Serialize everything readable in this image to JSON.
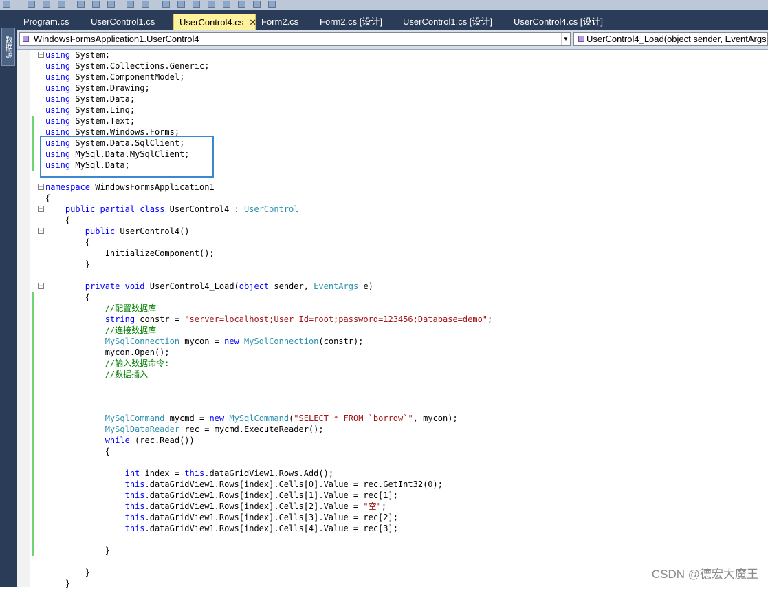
{
  "tabs": [
    {
      "label": "Program.cs",
      "active": false
    },
    {
      "label": "UserControl1.cs",
      "active": false
    },
    {
      "label": "UserControl4.cs",
      "active": true
    },
    {
      "label": "Form2.cs",
      "active": false
    },
    {
      "label": "Form2.cs [设计]",
      "active": false
    },
    {
      "label": "UserControl1.cs [设计]",
      "active": false
    },
    {
      "label": "UserControl4.cs [设计]",
      "active": false
    }
  ],
  "tab_close_glyph": "✕",
  "sidebar_label": "数据源",
  "nav": {
    "class_combo": "WindowsFormsApplication1.UserControl4",
    "member_combo": "UserControl4_Load(object sender, EventArgs e)"
  },
  "code_lines": [
    "using System;",
    "using System.Collections.Generic;",
    "using System.ComponentModel;",
    "using System.Drawing;",
    "using System.Data;",
    "using System.Linq;",
    "using System.Text;",
    "using System.Windows.Forms;",
    "using System.Data.SqlClient;",
    "using MySql.Data.MySqlClient;",
    "using MySql.Data;",
    "",
    "namespace WindowsFormsApplication1",
    "{",
    "    public partial class UserControl4 : UserControl",
    "    {",
    "        public UserControl4()",
    "        {",
    "            InitializeComponent();",
    "        }",
    "",
    "        private void UserControl4_Load(object sender, EventArgs e)",
    "        {",
    "            //配置数据库",
    "            string constr = \"server=localhost;User Id=root;password=123456;Database=demo\";",
    "            //连接数据库",
    "            MySqlConnection mycon = new MySqlConnection(constr);",
    "            mycon.Open();",
    "            //输入数据命令:",
    "            //数据插入",
    "",
    "",
    "",
    "            MySqlCommand mycmd = new MySqlCommand(\"SELECT * FROM `borrow`\", mycon);",
    "            MySqlDataReader rec = mycmd.ExecuteReader();",
    "            while (rec.Read())",
    "            {",
    "",
    "                int index = this.dataGridView1.Rows.Add();",
    "                this.dataGridView1.Rows[index].Cells[0].Value = rec.GetInt32(0);",
    "                this.dataGridView1.Rows[index].Cells[1].Value = rec[1];",
    "                this.dataGridView1.Rows[index].Cells[2].Value = \"空\";",
    "                this.dataGridView1.Rows[index].Cells[3].Value = rec[2];",
    "                this.dataGridView1.Rows[index].Cells[4].Value = rec[3];",
    "",
    "            }",
    "",
    "        }",
    "    }"
  ],
  "watermark": "CSDN @德宏大魔王",
  "colors": {
    "keyword": "#0000ff",
    "type": "#2b91af",
    "string": "#a31515",
    "comment": "#008000",
    "highlight_box": "#3a88cf",
    "active_tab": "#fff29d",
    "change_bar": "#6fd46f"
  }
}
